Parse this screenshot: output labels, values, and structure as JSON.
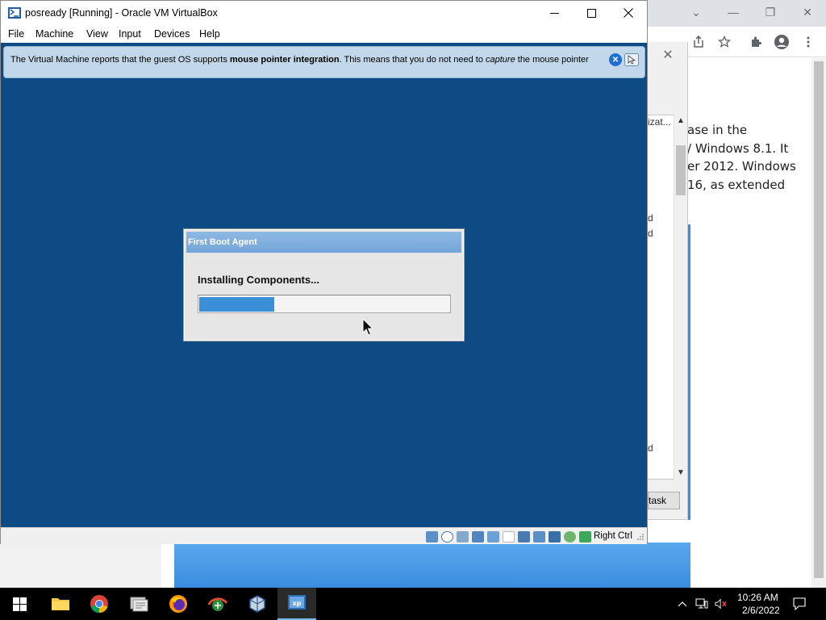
{
  "browser": {
    "window_controls": {
      "minimize": "—",
      "restore": "❐",
      "close": "✕",
      "tab_search": "⌄"
    },
    "toolbar_icons": [
      "share-icon",
      "bookmark-star-icon",
      "extensions-icon",
      "profile-icon",
      "menu-kebab-icon"
    ],
    "article_lines": [
      "ase in the",
      "/ Windows 8.1. It",
      "er 2012. Windows",
      "16, as extended"
    ]
  },
  "background_dialog": {
    "list_header": "izat...",
    "list_items": [
      "d",
      "d",
      "d"
    ],
    "button_label": "task"
  },
  "vbox": {
    "title": "posready [Running] - Oracle VM VirtualBox",
    "menu": [
      "File",
      "Machine",
      "View",
      "Input",
      "Devices",
      "Help"
    ],
    "notice": {
      "pre": "The Virtual Machine reports that the guest OS supports ",
      "bold": "mouse pointer integration",
      "mid": ". This means that you do not need to ",
      "italic": "capture",
      "post": " the mouse pointer"
    },
    "guest_dialog": {
      "title": "First Boot Agent",
      "message": "Installing Components...",
      "progress_fraction": 0.3
    },
    "status_bar": {
      "icons": [
        "hard-disk-icon",
        "optical-drive-icon",
        "audio-icon",
        "network-icon",
        "usb-icon",
        "shared-folders-icon",
        "display-icon",
        "recording-icon",
        "video-capture-icon",
        "virtualization-icon",
        "globe-icon",
        "download-icon"
      ],
      "host_key": "Right Ctrl"
    }
  },
  "taskbar": {
    "apps": [
      "start-button",
      "file-explorer",
      "google-chrome",
      "network-tool",
      "firefox",
      "network-monitor",
      "virtualbox",
      "posready-vm"
    ],
    "time": "10:26 AM",
    "date": "2/6/2022",
    "colors": {
      "accent": "#76b9ed"
    }
  }
}
